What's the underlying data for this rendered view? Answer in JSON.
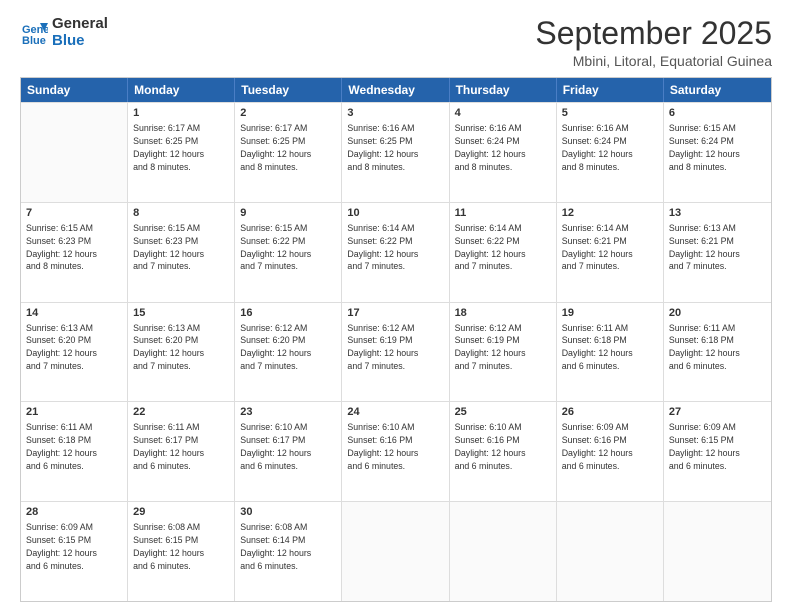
{
  "logo": {
    "line1": "General",
    "line2": "Blue"
  },
  "title": "September 2025",
  "location": "Mbini, Litoral, Equatorial Guinea",
  "weekdays": [
    "Sunday",
    "Monday",
    "Tuesday",
    "Wednesday",
    "Thursday",
    "Friday",
    "Saturday"
  ],
  "rows": [
    [
      {
        "day": "",
        "text": ""
      },
      {
        "day": "1",
        "text": "Sunrise: 6:17 AM\nSunset: 6:25 PM\nDaylight: 12 hours\nand 8 minutes."
      },
      {
        "day": "2",
        "text": "Sunrise: 6:17 AM\nSunset: 6:25 PM\nDaylight: 12 hours\nand 8 minutes."
      },
      {
        "day": "3",
        "text": "Sunrise: 6:16 AM\nSunset: 6:25 PM\nDaylight: 12 hours\nand 8 minutes."
      },
      {
        "day": "4",
        "text": "Sunrise: 6:16 AM\nSunset: 6:24 PM\nDaylight: 12 hours\nand 8 minutes."
      },
      {
        "day": "5",
        "text": "Sunrise: 6:16 AM\nSunset: 6:24 PM\nDaylight: 12 hours\nand 8 minutes."
      },
      {
        "day": "6",
        "text": "Sunrise: 6:15 AM\nSunset: 6:24 PM\nDaylight: 12 hours\nand 8 minutes."
      }
    ],
    [
      {
        "day": "7",
        "text": "Sunrise: 6:15 AM\nSunset: 6:23 PM\nDaylight: 12 hours\nand 8 minutes."
      },
      {
        "day": "8",
        "text": "Sunrise: 6:15 AM\nSunset: 6:23 PM\nDaylight: 12 hours\nand 7 minutes."
      },
      {
        "day": "9",
        "text": "Sunrise: 6:15 AM\nSunset: 6:22 PM\nDaylight: 12 hours\nand 7 minutes."
      },
      {
        "day": "10",
        "text": "Sunrise: 6:14 AM\nSunset: 6:22 PM\nDaylight: 12 hours\nand 7 minutes."
      },
      {
        "day": "11",
        "text": "Sunrise: 6:14 AM\nSunset: 6:22 PM\nDaylight: 12 hours\nand 7 minutes."
      },
      {
        "day": "12",
        "text": "Sunrise: 6:14 AM\nSunset: 6:21 PM\nDaylight: 12 hours\nand 7 minutes."
      },
      {
        "day": "13",
        "text": "Sunrise: 6:13 AM\nSunset: 6:21 PM\nDaylight: 12 hours\nand 7 minutes."
      }
    ],
    [
      {
        "day": "14",
        "text": "Sunrise: 6:13 AM\nSunset: 6:20 PM\nDaylight: 12 hours\nand 7 minutes."
      },
      {
        "day": "15",
        "text": "Sunrise: 6:13 AM\nSunset: 6:20 PM\nDaylight: 12 hours\nand 7 minutes."
      },
      {
        "day": "16",
        "text": "Sunrise: 6:12 AM\nSunset: 6:20 PM\nDaylight: 12 hours\nand 7 minutes."
      },
      {
        "day": "17",
        "text": "Sunrise: 6:12 AM\nSunset: 6:19 PM\nDaylight: 12 hours\nand 7 minutes."
      },
      {
        "day": "18",
        "text": "Sunrise: 6:12 AM\nSunset: 6:19 PM\nDaylight: 12 hours\nand 7 minutes."
      },
      {
        "day": "19",
        "text": "Sunrise: 6:11 AM\nSunset: 6:18 PM\nDaylight: 12 hours\nand 6 minutes."
      },
      {
        "day": "20",
        "text": "Sunrise: 6:11 AM\nSunset: 6:18 PM\nDaylight: 12 hours\nand 6 minutes."
      }
    ],
    [
      {
        "day": "21",
        "text": "Sunrise: 6:11 AM\nSunset: 6:18 PM\nDaylight: 12 hours\nand 6 minutes."
      },
      {
        "day": "22",
        "text": "Sunrise: 6:11 AM\nSunset: 6:17 PM\nDaylight: 12 hours\nand 6 minutes."
      },
      {
        "day": "23",
        "text": "Sunrise: 6:10 AM\nSunset: 6:17 PM\nDaylight: 12 hours\nand 6 minutes."
      },
      {
        "day": "24",
        "text": "Sunrise: 6:10 AM\nSunset: 6:16 PM\nDaylight: 12 hours\nand 6 minutes."
      },
      {
        "day": "25",
        "text": "Sunrise: 6:10 AM\nSunset: 6:16 PM\nDaylight: 12 hours\nand 6 minutes."
      },
      {
        "day": "26",
        "text": "Sunrise: 6:09 AM\nSunset: 6:16 PM\nDaylight: 12 hours\nand 6 minutes."
      },
      {
        "day": "27",
        "text": "Sunrise: 6:09 AM\nSunset: 6:15 PM\nDaylight: 12 hours\nand 6 minutes."
      }
    ],
    [
      {
        "day": "28",
        "text": "Sunrise: 6:09 AM\nSunset: 6:15 PM\nDaylight: 12 hours\nand 6 minutes."
      },
      {
        "day": "29",
        "text": "Sunrise: 6:08 AM\nSunset: 6:15 PM\nDaylight: 12 hours\nand 6 minutes."
      },
      {
        "day": "30",
        "text": "Sunrise: 6:08 AM\nSunset: 6:14 PM\nDaylight: 12 hours\nand 6 minutes."
      },
      {
        "day": "",
        "text": ""
      },
      {
        "day": "",
        "text": ""
      },
      {
        "day": "",
        "text": ""
      },
      {
        "day": "",
        "text": ""
      }
    ]
  ]
}
